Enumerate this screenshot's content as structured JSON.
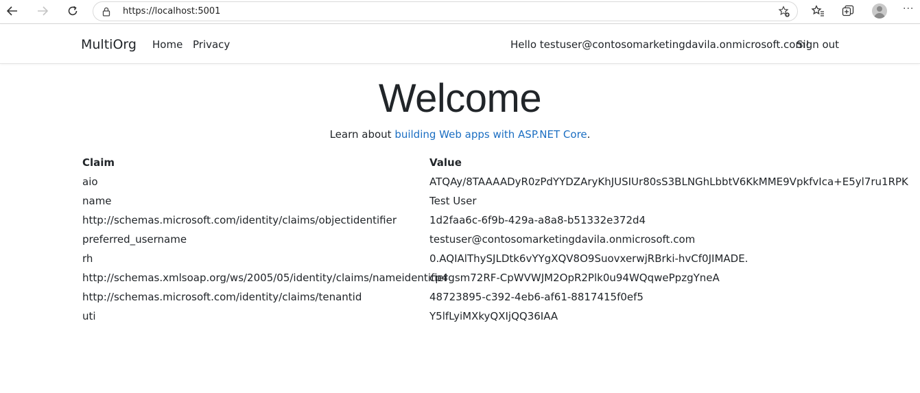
{
  "browser": {
    "url": "https://localhost:5001",
    "icons": [
      "back-icon",
      "forward-icon",
      "refresh-icon",
      "lock-icon",
      "add-favorite-icon",
      "favorites-icon",
      "collections-icon",
      "profile-icon",
      "more-icon"
    ]
  },
  "navbar": {
    "brand": "MultiOrg",
    "links": [
      "Home",
      "Privacy"
    ],
    "greeting": "Hello testuser@contosomarketingdavila.onmicrosoft.com!",
    "signout": "Sign out"
  },
  "main": {
    "title": "Welcome",
    "learn_prefix": "Learn about ",
    "learn_link": "building Web apps with ASP.NET Core",
    "learn_suffix": ".",
    "table": {
      "headers": [
        "Claim",
        "Value"
      ],
      "rows": [
        [
          "aio",
          "ATQAy/8TAAAADyR0zPdYYDZAryKhJUSIUr80sS3BLNGhLbbtV6KkMME9VpkfvIca+E5yl7ru1RPK"
        ],
        [
          "name",
          "Test User"
        ],
        [
          "http://schemas.microsoft.com/identity/claims/objectidentifier",
          "1d2faa6c-6f9b-429a-a8a8-b51332e372d4"
        ],
        [
          "preferred_username",
          "testuser@contosomarketingdavila.onmicrosoft.com"
        ],
        [
          "rh",
          "0.AQIAlThySJLDtk6vYYgXQV8O9SuovxerwjRBrki-hvCf0JIMADE."
        ],
        [
          "http://schemas.xmlsoap.org/ws/2005/05/identity/claims/nameidentifier",
          "cp4gsm72RF-CpWVWJM2OpR2Plk0u94WQqwePpzgYneA"
        ],
        [
          "http://schemas.microsoft.com/identity/claims/tenantid",
          "48723895-c392-4eb6-af61-8817415f0ef5"
        ],
        [
          "uti",
          "Y5lfLyiMXkyQXIjQQ36IAA"
        ]
      ]
    }
  }
}
